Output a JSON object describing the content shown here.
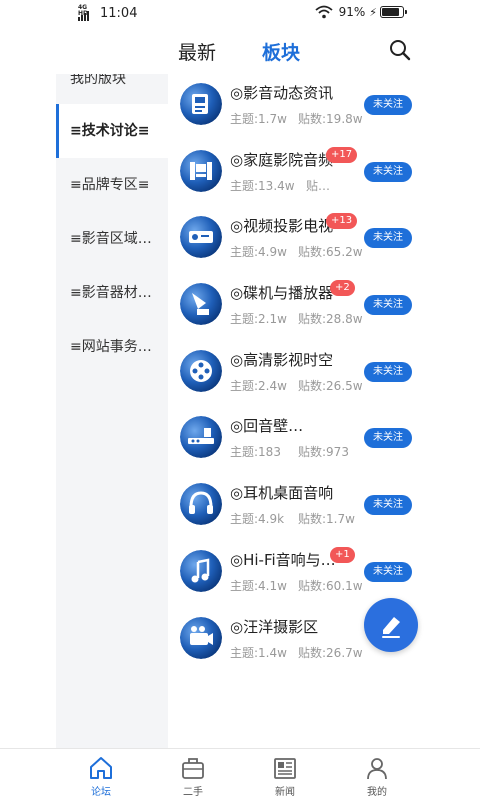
{
  "status_bar": {
    "time": "11:04",
    "network": "4G HD",
    "battery": "91%"
  },
  "header": {
    "tabs": [
      {
        "label": "最新",
        "active": false
      },
      {
        "label": "板块",
        "active": true
      }
    ],
    "search_icon": "search-icon"
  },
  "sidebar": {
    "items": [
      {
        "label": "我的版块",
        "active": false
      },
      {
        "label": "≡技术讨论≡",
        "active": true
      },
      {
        "label": "≡品牌专区≡",
        "active": false
      },
      {
        "label": "≡影音区域…",
        "active": false
      },
      {
        "label": "≡影音器材…",
        "active": false
      },
      {
        "label": "≡网站事务…",
        "active": false
      }
    ]
  },
  "boards": [
    {
      "title": "◎影音动态资讯",
      "badge": "",
      "topics": "主题:1.7w",
      "posts": "贴数:19.8w",
      "follow": "未关注",
      "icon": "news-icon"
    },
    {
      "title": "◎家庭影院音频",
      "badge": "+17",
      "topics": "主题:13.4w",
      "posts": "贴…",
      "follow": "未关注",
      "icon": "home-theater-icon"
    },
    {
      "title": "◎视频投影电视",
      "badge": "+13",
      "topics": "主题:4.9w",
      "posts": "贴数:65.2w",
      "follow": "未关注",
      "icon": "projector-icon"
    },
    {
      "title": "◎碟机与播放器",
      "badge": "+2",
      "topics": "主题:2.1w",
      "posts": "贴数:28.8w",
      "follow": "未关注",
      "icon": "gramophone-icon"
    },
    {
      "title": "◎高清影视时空",
      "badge": "",
      "topics": "主题:2.4w",
      "posts": "贴数:26.5w",
      "follow": "未关注",
      "icon": "film-reel-icon"
    },
    {
      "title": "◎回音壁…",
      "badge": "",
      "topics": "主题:183",
      "posts": "贴数:973",
      "follow": "未关注",
      "icon": "soundbar-icon"
    },
    {
      "title": "◎耳机桌面音响",
      "badge": "",
      "topics": "主题:4.9k",
      "posts": "贴数:1.7w",
      "follow": "未关注",
      "icon": "headphones-icon"
    },
    {
      "title": "◎Hi-Fi音响与…",
      "badge": "+1",
      "topics": "主题:4.1w",
      "posts": "贴数:60.1w",
      "follow": "未关注",
      "icon": "music-note-icon"
    },
    {
      "title": "◎汪洋摄影区",
      "badge": "",
      "topics": "主题:1.4w",
      "posts": "贴数:26.7w",
      "follow": "",
      "icon": "camera-icon"
    }
  ],
  "fab": {
    "icon": "edit-icon"
  },
  "bottom_nav": [
    {
      "label": "论坛",
      "icon": "home-icon",
      "active": true
    },
    {
      "label": "二手",
      "icon": "briefcase-icon",
      "active": false
    },
    {
      "label": "新闻",
      "icon": "newspaper-icon",
      "active": false
    },
    {
      "label": "我的",
      "icon": "user-icon",
      "active": false
    }
  ],
  "colors": {
    "accent": "#1e6fd9",
    "badge": "#f25757",
    "muted_text": "#999999",
    "sidebar_bg": "#f4f5f7"
  }
}
